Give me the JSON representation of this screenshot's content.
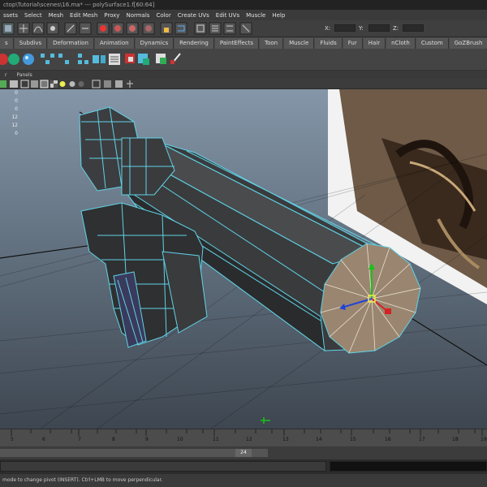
{
  "window": {
    "title": "ctop\\Tutorial\\scenes\\16.ma*   ---   polySurface1.f[60:64]"
  },
  "menubar": {
    "items": [
      "ssets",
      "Select",
      "Mesh",
      "Edit Mesh",
      "Proxy",
      "Normals",
      "Color",
      "Create UVs",
      "Edit UVs",
      "Muscle",
      "Help"
    ]
  },
  "status_line": {
    "x_label": "X:",
    "y_label": "Y:",
    "z_label": "Z:",
    "x_value": "",
    "y_value": "",
    "z_value": ""
  },
  "shelf_tabs": [
    "s",
    "Subdivs",
    "Deformation",
    "Animation",
    "Dynamics",
    "Rendering",
    "PaintEffects",
    "Toon",
    "Muscle",
    "Fluids",
    "Fur",
    "Hair",
    "nCloth",
    "Custom",
    "GoZBrush"
  ],
  "panel_menu": {
    "items": [
      "r",
      "Panels"
    ]
  },
  "hud": {
    "values": [
      "0",
      "0",
      "0",
      "12",
      "12",
      "0"
    ]
  },
  "timeline": {
    "ticks": [
      "5",
      "6",
      "7",
      "8",
      "9",
      "10",
      "11",
      "12",
      "13",
      "14",
      "15",
      "16",
      "17",
      "18",
      "19",
      "20"
    ],
    "current": "24"
  },
  "help_line": {
    "text": "mode to change pivot (INSERT).  Ctrl+LMB to move perpendicular."
  },
  "colors": {
    "wire": "#5fd3e6",
    "mesh": "#3a3b3d",
    "face_selected": "#9a8670",
    "viewport_top": "#8496a8",
    "viewport_bottom": "#3e4650"
  }
}
